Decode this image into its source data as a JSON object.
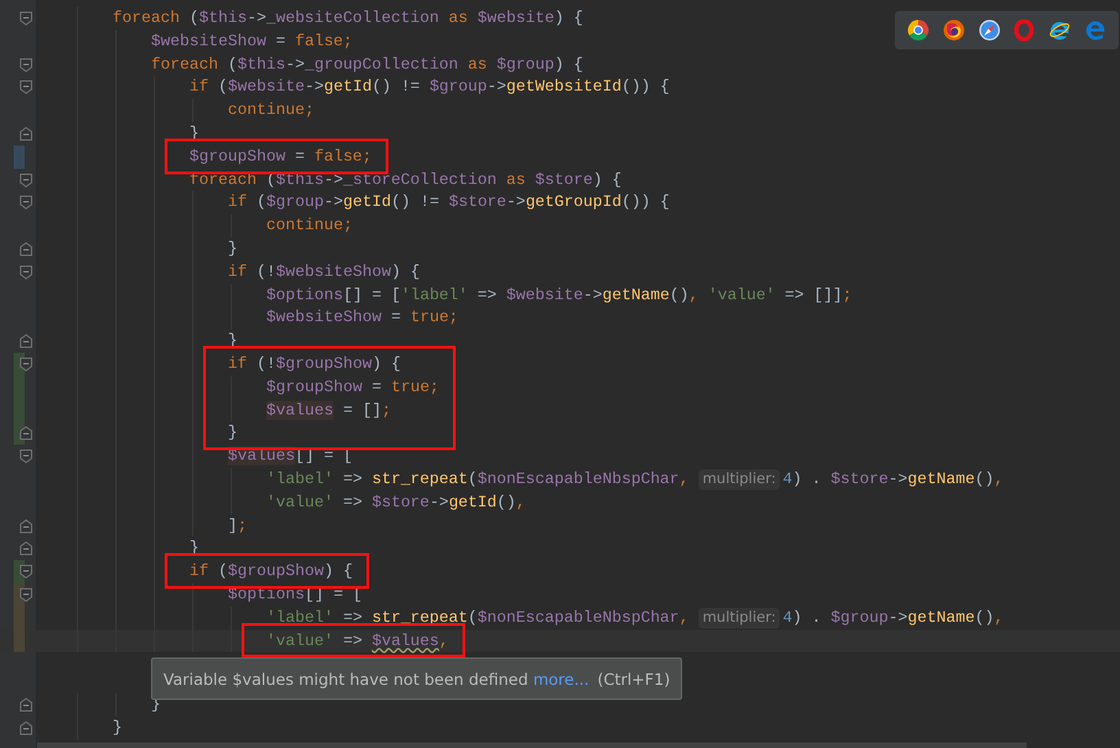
{
  "browser_bar": {
    "browsers": [
      {
        "kind": "chrome"
      },
      {
        "kind": "firefox"
      },
      {
        "kind": "safari"
      },
      {
        "kind": "opera"
      },
      {
        "kind": "ie"
      },
      {
        "kind": "edge"
      }
    ]
  },
  "editor": {
    "lines": [
      {
        "fold_start": true,
        "tokens": [
          {
            "kind": "kw",
            "t": "foreach"
          },
          {
            "kind": "p",
            "t": " ("
          },
          {
            "kind": "var",
            "t": "$this"
          },
          {
            "kind": "p",
            "t": "->"
          },
          {
            "kind": "var",
            "t": "_websiteCollection"
          },
          {
            "kind": "kw",
            "t": " as "
          },
          {
            "kind": "var",
            "t": "$website"
          },
          {
            "kind": "p",
            "t": ") {"
          }
        ],
        "children": [
          {
            "tokens": [
              {
                "kind": "var",
                "t": "$websiteShow"
              },
              {
                "kind": "p",
                "t": " = "
              },
              {
                "kind": "kw",
                "t": "false;"
              }
            ]
          },
          {
            "fold_start": true,
            "tokens": [
              {
                "kind": "kw",
                "t": "foreach"
              },
              {
                "kind": "p",
                "t": " ("
              },
              {
                "kind": "var",
                "t": "$this"
              },
              {
                "kind": "p",
                "t": "->"
              },
              {
                "kind": "var",
                "t": "_groupCollection"
              },
              {
                "kind": "kw",
                "t": " as "
              },
              {
                "kind": "var",
                "t": "$group"
              },
              {
                "kind": "p",
                "t": ") {"
              }
            ],
            "children": [
              {
                "fold_start": true,
                "tokens": [
                  {
                    "kind": "kw",
                    "t": "if"
                  },
                  {
                    "kind": "p",
                    "t": " ("
                  },
                  {
                    "kind": "var",
                    "t": "$website"
                  },
                  {
                    "kind": "p",
                    "t": "->"
                  },
                  {
                    "kind": "fn",
                    "t": "getId"
                  },
                  {
                    "kind": "p",
                    "t": "() != "
                  },
                  {
                    "kind": "var",
                    "t": "$group"
                  },
                  {
                    "kind": "p",
                    "t": "->"
                  },
                  {
                    "kind": "fn",
                    "t": "getWebsiteId"
                  },
                  {
                    "kind": "p",
                    "t": "()) {"
                  }
                ],
                "children": [
                  {
                    "tokens": [
                      {
                        "kind": "kw",
                        "t": "continue;"
                      }
                    ]
                  }
                ]
              },
              {
                "fold_end": true,
                "tokens": [
                  {
                    "kind": "p",
                    "t": "}"
                  }
                ]
              },
              {
                "color": "#374a5c",
                "boxed": true,
                "tokens": [
                  {
                    "kind": "var",
                    "t": "$groupShow"
                  },
                  {
                    "kind": "p",
                    "t": " = "
                  },
                  {
                    "kind": "kw",
                    "t": "false;"
                  }
                ]
              },
              {
                "fold_start": true,
                "tokens": [
                  {
                    "kind": "kw",
                    "t": "foreach"
                  },
                  {
                    "kind": "p",
                    "t": " ("
                  },
                  {
                    "kind": "var",
                    "t": "$this"
                  },
                  {
                    "kind": "p",
                    "t": "->"
                  },
                  {
                    "kind": "var",
                    "t": "_storeCollection"
                  },
                  {
                    "kind": "kw",
                    "t": " as "
                  },
                  {
                    "kind": "var",
                    "t": "$store"
                  },
                  {
                    "kind": "p",
                    "t": ") {"
                  }
                ],
                "children": [
                  {
                    "fold_start": true,
                    "tokens": [
                      {
                        "kind": "kw",
                        "t": "if"
                      },
                      {
                        "kind": "p",
                        "t": " ("
                      },
                      {
                        "kind": "var",
                        "t": "$group"
                      },
                      {
                        "kind": "p",
                        "t": "->"
                      },
                      {
                        "kind": "fn",
                        "t": "getId"
                      },
                      {
                        "kind": "p",
                        "t": "() != "
                      },
                      {
                        "kind": "var",
                        "t": "$store"
                      },
                      {
                        "kind": "p",
                        "t": "->"
                      },
                      {
                        "kind": "fn",
                        "t": "getGroupId"
                      },
                      {
                        "kind": "p",
                        "t": "()) {"
                      }
                    ],
                    "children": [
                      {
                        "tokens": [
                          {
                            "kind": "kw",
                            "t": "continue;"
                          }
                        ]
                      }
                    ]
                  },
                  {
                    "fold_end": true,
                    "tokens": [
                      {
                        "kind": "p",
                        "t": "}"
                      }
                    ]
                  },
                  {
                    "fold_start": true,
                    "tokens": [
                      {
                        "kind": "kw",
                        "t": "if"
                      },
                      {
                        "kind": "p",
                        "t": " (!"
                      },
                      {
                        "kind": "var",
                        "t": "$websiteShow"
                      },
                      {
                        "kind": "p",
                        "t": ") {"
                      }
                    ],
                    "children": [
                      {
                        "tokens": [
                          {
                            "kind": "var",
                            "t": "$options"
                          },
                          {
                            "kind": "p",
                            "t": "[] = ["
                          },
                          {
                            "kind": "str",
                            "t": "'label'"
                          },
                          {
                            "kind": "p",
                            "t": " => "
                          },
                          {
                            "kind": "var",
                            "t": "$website"
                          },
                          {
                            "kind": "p",
                            "t": "->"
                          },
                          {
                            "kind": "fn",
                            "t": "getName"
                          },
                          {
                            "kind": "p",
                            "t": "()"
                          },
                          {
                            "kind": "kw",
                            "t": ","
                          },
                          {
                            "kind": "str",
                            "t": " 'value'"
                          },
                          {
                            "kind": "p",
                            "t": " => []]"
                          },
                          {
                            "kind": "kw",
                            "t": ";"
                          }
                        ]
                      },
                      {
                        "tokens": [
                          {
                            "kind": "var",
                            "t": "$websiteShow"
                          },
                          {
                            "kind": "p",
                            "t": " = "
                          },
                          {
                            "kind": "kw",
                            "t": "true;"
                          }
                        ]
                      }
                    ]
                  },
                  {
                    "fold_end": true,
                    "tokens": [
                      {
                        "kind": "p",
                        "t": "}"
                      }
                    ]
                  },
                  {
                    "fold_start": true,
                    "color": "#384c38",
                    "boxed": true,
                    "tokens": [
                      {
                        "kind": "kw",
                        "t": "if"
                      },
                      {
                        "kind": "p",
                        "t": " (!"
                      },
                      {
                        "kind": "var",
                        "t": "$groupShow"
                      },
                      {
                        "kind": "p",
                        "t": ") {"
                      }
                    ],
                    "children": [
                      {
                        "color": "#384c38",
                        "boxed": true,
                        "tokens": [
                          {
                            "kind": "var",
                            "t": "$groupShow"
                          },
                          {
                            "kind": "p",
                            "t": " = "
                          },
                          {
                            "kind": "kw",
                            "t": "true;"
                          }
                        ]
                      },
                      {
                        "color": "#384c38",
                        "boxed": true,
                        "tokens": [
                          {
                            "kind": "var_hl",
                            "t": "$values"
                          },
                          {
                            "kind": "p",
                            "t": " = []"
                          },
                          {
                            "kind": "kw",
                            "t": ";"
                          }
                        ]
                      }
                    ]
                  },
                  {
                    "fold_end": true,
                    "color": "#384c38",
                    "boxed": true,
                    "tokens": [
                      {
                        "kind": "p",
                        "t": "}"
                      }
                    ]
                  },
                  {
                    "fold_start": true,
                    "tokens": [
                      {
                        "kind": "var_hl",
                        "t": "$values"
                      },
                      {
                        "kind": "p",
                        "t": "[] = ["
                      }
                    ],
                    "children": [
                      {
                        "tokens": [
                          {
                            "kind": "str",
                            "t": "'label'"
                          },
                          {
                            "kind": "p",
                            "t": " => "
                          },
                          {
                            "kind": "fn",
                            "t": "str_repeat"
                          },
                          {
                            "kind": "p",
                            "t": "("
                          },
                          {
                            "kind": "var",
                            "t": "$nonEscapableNbspChar"
                          },
                          {
                            "kind": "kw",
                            "t": ","
                          },
                          {
                            "kind": "hint",
                            "t": "multiplier:"
                          },
                          {
                            "kind": "num",
                            "t": "4"
                          },
                          {
                            "kind": "p",
                            "t": ") . "
                          },
                          {
                            "kind": "var",
                            "t": "$store"
                          },
                          {
                            "kind": "p",
                            "t": "->"
                          },
                          {
                            "kind": "fn",
                            "t": "getName"
                          },
                          {
                            "kind": "p",
                            "t": "()"
                          },
                          {
                            "kind": "kw",
                            "t": ","
                          }
                        ]
                      },
                      {
                        "tokens": [
                          {
                            "kind": "str",
                            "t": "'value'"
                          },
                          {
                            "kind": "p",
                            "t": " => "
                          },
                          {
                            "kind": "var",
                            "t": "$store"
                          },
                          {
                            "kind": "p",
                            "t": "->"
                          },
                          {
                            "kind": "fn",
                            "t": "getId"
                          },
                          {
                            "kind": "p",
                            "t": "()"
                          },
                          {
                            "kind": "kw",
                            "t": ","
                          }
                        ]
                      }
                    ]
                  },
                  {
                    "fold_end": true,
                    "tokens": [
                      {
                        "kind": "p",
                        "t": "]"
                      },
                      {
                        "kind": "kw",
                        "t": ";"
                      }
                    ]
                  }
                ]
              },
              {
                "fold_end": true,
                "tokens": [
                  {
                    "kind": "p",
                    "t": "}"
                  }
                ]
              },
              {
                "fold_start": true,
                "color": "#384c38",
                "boxed": true,
                "tokens": [
                  {
                    "kind": "kw",
                    "t": "if"
                  },
                  {
                    "kind": "p",
                    "t": " ("
                  },
                  {
                    "kind": "var",
                    "t": "$groupShow"
                  },
                  {
                    "kind": "p",
                    "t": ") {"
                  }
                ],
                "children": [
                  {
                    "fold_start": true,
                    "color": "#4b4536",
                    "tokens": [
                      {
                        "kind": "var",
                        "t": "$options"
                      },
                      {
                        "kind": "p",
                        "t": "[] = ["
                      }
                    ],
                    "children": [
                      {
                        "color": "#4b4536",
                        "tokens": [
                          {
                            "kind": "str",
                            "t": "'label'"
                          },
                          {
                            "kind": "p",
                            "t": " => "
                          },
                          {
                            "kind": "fn",
                            "t": "str_repeat"
                          },
                          {
                            "kind": "p",
                            "t": "("
                          },
                          {
                            "kind": "var",
                            "t": "$nonEscapableNbspChar"
                          },
                          {
                            "kind": "kw",
                            "t": ","
                          },
                          {
                            "kind": "hint",
                            "t": "multiplier:"
                          },
                          {
                            "kind": "num",
                            "t": "4"
                          },
                          {
                            "kind": "p",
                            "t": ") . "
                          },
                          {
                            "kind": "var",
                            "t": "$group"
                          },
                          {
                            "kind": "p",
                            "t": "->"
                          },
                          {
                            "kind": "fn",
                            "t": "getName"
                          },
                          {
                            "kind": "p",
                            "t": "()"
                          },
                          {
                            "kind": "kw",
                            "t": ","
                          }
                        ]
                      },
                      {
                        "color": "#4b4536",
                        "boxed": true,
                        "current": true,
                        "tokens": [
                          {
                            "kind": "str",
                            "t": "'value'"
                          },
                          {
                            "kind": "p",
                            "t": " => "
                          },
                          {
                            "kind": "var_warn",
                            "t": "$values"
                          },
                          {
                            "kind": "kw",
                            "t": ","
                          }
                        ]
                      }
                    ]
                  }
                ]
              }
            ]
          },
          {
            "fold_end": true,
            "tokens": [
              {
                "kind": "p",
                "t": "}"
              }
            ]
          }
        ]
      },
      {
        "fold_end": true,
        "tokens": [
          {
            "kind": "p",
            "t": "}"
          }
        ]
      }
    ]
  },
  "tooltip": {
    "message": "Variable $values might have not been defined",
    "link": "more...",
    "shortcut": "(Ctrl+F1)"
  }
}
